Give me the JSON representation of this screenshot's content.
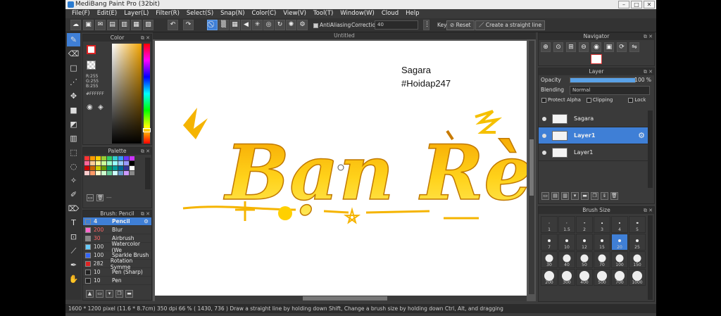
{
  "window": {
    "title": "MediBang Paint Pro (32bit)"
  },
  "menu": [
    "File(F)",
    "Edit(E)",
    "Layer(L)",
    "Filter(R)",
    "Select(S)",
    "Snap(N)",
    "Color(C)",
    "View(V)",
    "Tool(T)",
    "Window(W)",
    "Cloud",
    "Help"
  ],
  "toolbar": {
    "antialiasing_label": "AntiAliasing",
    "correction_label": "Correction",
    "correction_value": "40",
    "key_label": "Key",
    "reset_label": "Reset",
    "straight_line_label": "Create a straight line"
  },
  "color_panel": {
    "title": "Color",
    "r": "R:255",
    "g": "G:255",
    "b": "B:255",
    "hex": "#FFFFFF"
  },
  "palette_panel": {
    "title": "Palette",
    "more": "---"
  },
  "brush_panel": {
    "title": "Brush: Pencil",
    "items": [
      {
        "size": "4",
        "name": "Pencil",
        "color": "#3f7fd6"
      },
      {
        "size": "200",
        "name": "Blur",
        "color": "#ff66cc"
      },
      {
        "size": "30",
        "name": "Airbrush",
        "color": "#888888"
      },
      {
        "size": "100",
        "name": "Watercolor (We",
        "color": "#66ccff"
      },
      {
        "size": "100",
        "name": "Sparkle Brush",
        "color": "#3366ff"
      },
      {
        "size": "282",
        "name": "Rotation Symme",
        "color": "#dd2222"
      },
      {
        "size": "10",
        "name": "Pen (Sharp)",
        "color": "#222222"
      },
      {
        "size": "10",
        "name": "Pen",
        "color": "#222222"
      }
    ]
  },
  "document": {
    "tab_title": "Untitled",
    "text_line1": "Sagara",
    "text_line2": "#Hoidap247",
    "artwork_text": "Bạn Rè"
  },
  "navigator": {
    "title": "Navigator"
  },
  "layer_panel": {
    "title": "Layer",
    "opacity_label": "Opacity",
    "opacity_value": "100 %",
    "opacity_fraction": 1.0,
    "blending_label": "Blending",
    "blending_value": "Normal",
    "protect_alpha": "Protect Alpha",
    "clipping": "Clipping",
    "lock": "Lock",
    "layers": [
      {
        "name": "Sagara",
        "active": false
      },
      {
        "name": "Layer1",
        "active": true
      },
      {
        "name": "Layer1",
        "active": false
      }
    ]
  },
  "brush_size_panel": {
    "title": "Brush Size",
    "sizes": [
      "1",
      "1.5",
      "2",
      "3",
      "4",
      "5",
      "7",
      "10",
      "12",
      "15",
      "20",
      "25",
      "30",
      "40",
      "50",
      "70",
      "100",
      "150",
      "200",
      "300",
      "400",
      "500",
      "700",
      "1000"
    ],
    "selected": "20"
  },
  "status": {
    "text": "1600 * 1200 pixel   (11.6 * 8.7cm)   350 dpi   66 %   ( 1430, 736 )   Draw a straight line by holding down Shift, Change a brush size by holding down Ctrl, Alt, and dragging"
  }
}
